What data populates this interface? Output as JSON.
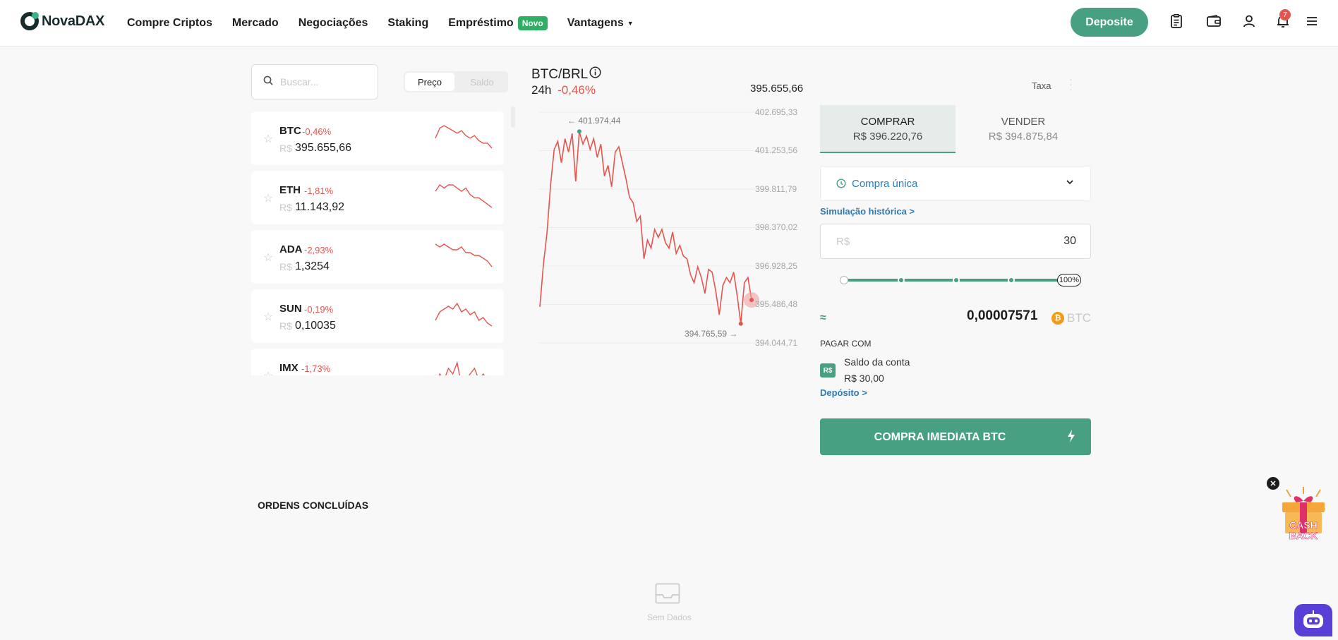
{
  "header": {
    "logo_text": "NovaDAX",
    "nav": [
      {
        "label": "Compre Criptos"
      },
      {
        "label": "Mercado"
      },
      {
        "label": "Negociações"
      },
      {
        "label": "Staking"
      },
      {
        "label": "Empréstimo",
        "badge": "Novo"
      },
      {
        "label": "Vantagens",
        "has_dropdown": true
      }
    ],
    "deposit_label": "Deposite",
    "icons": [
      "orders-icon",
      "wallet-icon",
      "user-icon",
      "bell-icon",
      "menu-icon"
    ],
    "notification_count": "7",
    "accent_color": "#46a081"
  },
  "markets": {
    "search_placeholder": "Buscar...",
    "sort_tabs": [
      "Preço",
      "Saldo"
    ],
    "active_tab": "Preço",
    "currency_prefix": "R$",
    "coins": [
      {
        "symbol": "BTC",
        "change": "-0,46%",
        "price": "395.655,66",
        "spark": [
          5,
          9,
          10,
          9,
          8,
          7,
          8,
          6,
          5,
          6,
          4,
          3,
          3,
          1
        ]
      },
      {
        "symbol": "ETH",
        "change": "-1,81%",
        "price": "11.143,92",
        "spark": [
          7,
          9,
          8,
          9,
          9,
          8,
          7,
          8,
          6,
          5,
          5,
          4,
          3,
          2
        ]
      },
      {
        "symbol": "ADA",
        "change": "-2,93%",
        "price": "1,3254",
        "spark": [
          9,
          8,
          9,
          8,
          7,
          7,
          8,
          6,
          6,
          5,
          5,
          4,
          3,
          1
        ]
      },
      {
        "symbol": "SUN",
        "change": "-0,19%",
        "price": "0,10035",
        "spark": [
          3,
          6,
          7,
          8,
          7,
          9,
          6,
          7,
          5,
          6,
          3,
          4,
          2,
          1
        ]
      },
      {
        "symbol": "IMX",
        "change": "-1,73%",
        "price": "",
        "spark": [
          5,
          7,
          6,
          8,
          7,
          9,
          5,
          6,
          7,
          8,
          6,
          7,
          6,
          5
        ]
      }
    ],
    "down_color": "#e5554f"
  },
  "chart": {
    "pair": "BTC/BRL",
    "period": "24h",
    "change": "-0,46%",
    "last_price": "395.655,66",
    "high_marker": "401.974,44",
    "low_marker": "394.765,59",
    "y_ticks": [
      "402.695,33",
      "401.253,56",
      "399.811,79",
      "398.370,02",
      "396.928,25",
      "395.486,48",
      "394.044,71"
    ]
  },
  "chart_data": {
    "type": "line",
    "title": "BTC/BRL",
    "xlabel": "",
    "ylabel": "",
    "ylim": [
      394044.71,
      402695.33
    ],
    "yticks": [
      402695.33,
      401253.56,
      399811.79,
      398370.02,
      396928.25,
      395486.48,
      394044.71
    ],
    "grid": true,
    "series": [
      {
        "values": [
          395400,
          397000,
          398200,
          400000,
          401300,
          401600,
          400800,
          401700,
          401200,
          401900,
          400100,
          401974.44,
          401500,
          401800,
          401300,
          401700,
          401000,
          401500,
          400300,
          400700,
          399900,
          401200,
          401400,
          400800,
          400200,
          399500,
          399300,
          398600,
          398800,
          397200,
          397900,
          397600,
          398300,
          398000,
          398300,
          397800,
          397600,
          398200,
          397400,
          397700,
          397300,
          397200,
          396600,
          396300,
          396900,
          396500,
          395900,
          396800,
          396700,
          396000,
          395100,
          396200,
          396500,
          396300,
          396700,
          395800,
          394765.59,
          396300,
          396500,
          395655.66
        ]
      }
    ]
  },
  "order": {
    "fee_label": "Taxa",
    "tabs": [
      {
        "label": "COMPRAR",
        "price": "R$ 396.220,76"
      },
      {
        "label": "VENDER",
        "price": "R$ 394.875,84"
      }
    ],
    "order_type": "Compra única",
    "history_link": "Simulação histórica >",
    "amount_prefix": "R$",
    "amount_value": "30",
    "slider_percent_label": "100%",
    "slider_fraction": 1.0,
    "approx_symbol": "≈",
    "estimate": "0,00007571",
    "estimate_unit": "BTC",
    "coin_badge": "₿",
    "pay_with_label": "PAGAR COM",
    "account_badge": "R$",
    "account_label": "Saldo da conta",
    "account_balance": "R$ 30,00",
    "deposit_link": "Depósito >",
    "buy_button": "COMPRA IMEDIATA BTC"
  },
  "history": {
    "title": "ORDENS CONCLUÍDAS",
    "empty_text": "Sem Dados"
  },
  "cashback": {
    "line1": "CASH",
    "line2": "BACK"
  }
}
